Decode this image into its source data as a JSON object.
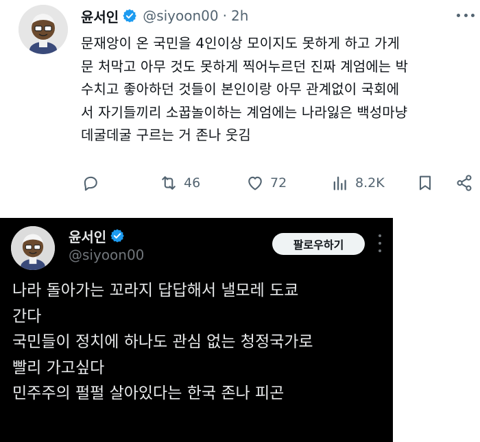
{
  "tweet_top": {
    "display_name": "윤서인",
    "verified_icon": "verified-badge-icon",
    "handle": "@siyoon00",
    "separator": "·",
    "time": "2h",
    "more_icon": "more-horizontal-icon",
    "text_lines": [
      "문재앙이 온 국민을 4인이상 모이지도 못하게 하고 가게",
      "문 처막고 아무 것도 못하게 찍어누르던 진짜 계엄에는 박",
      "수치고 좋아하던 것들이 본인이랑 아무 관계없이 국회에",
      "서 자기들끼리 소꿉놀이하는 계엄에는 나라잃은 백성마냥",
      "데굴데굴 구르는 거 존나 웃김"
    ],
    "actions": {
      "reply_icon": "reply-icon",
      "retweet_icon": "retweet-icon",
      "retweet_count": "46",
      "like_icon": "heart-icon",
      "like_count": "72",
      "views_icon": "views-chart-icon",
      "views_count": "8.2K",
      "bookmark_icon": "bookmark-icon",
      "share_icon": "share-icon"
    }
  },
  "tweet_bottom": {
    "display_name": "윤서인",
    "verified_icon": "verified-badge-icon",
    "handle": "@siyoon00",
    "follow_label": "팔로우하기",
    "more_icon": "more-vertical-icon",
    "text_lines": [
      "나라 돌아가는 꼬라지 답답해서 낼모레 도쿄",
      "간다",
      "국민들이 정치에 하나도 관심 없는 청정국가로",
      "빨리 가고싶다",
      "민주주의 펄펄 살아있다는 한국 존나 피곤"
    ]
  },
  "colors": {
    "verified_blue": "#1d9bf0",
    "text_primary_light": "#0f1419",
    "text_secondary_light": "#536471",
    "background_dark": "#000000",
    "text_primary_dark": "#e7e9ea",
    "text_secondary_dark": "#71767b"
  }
}
